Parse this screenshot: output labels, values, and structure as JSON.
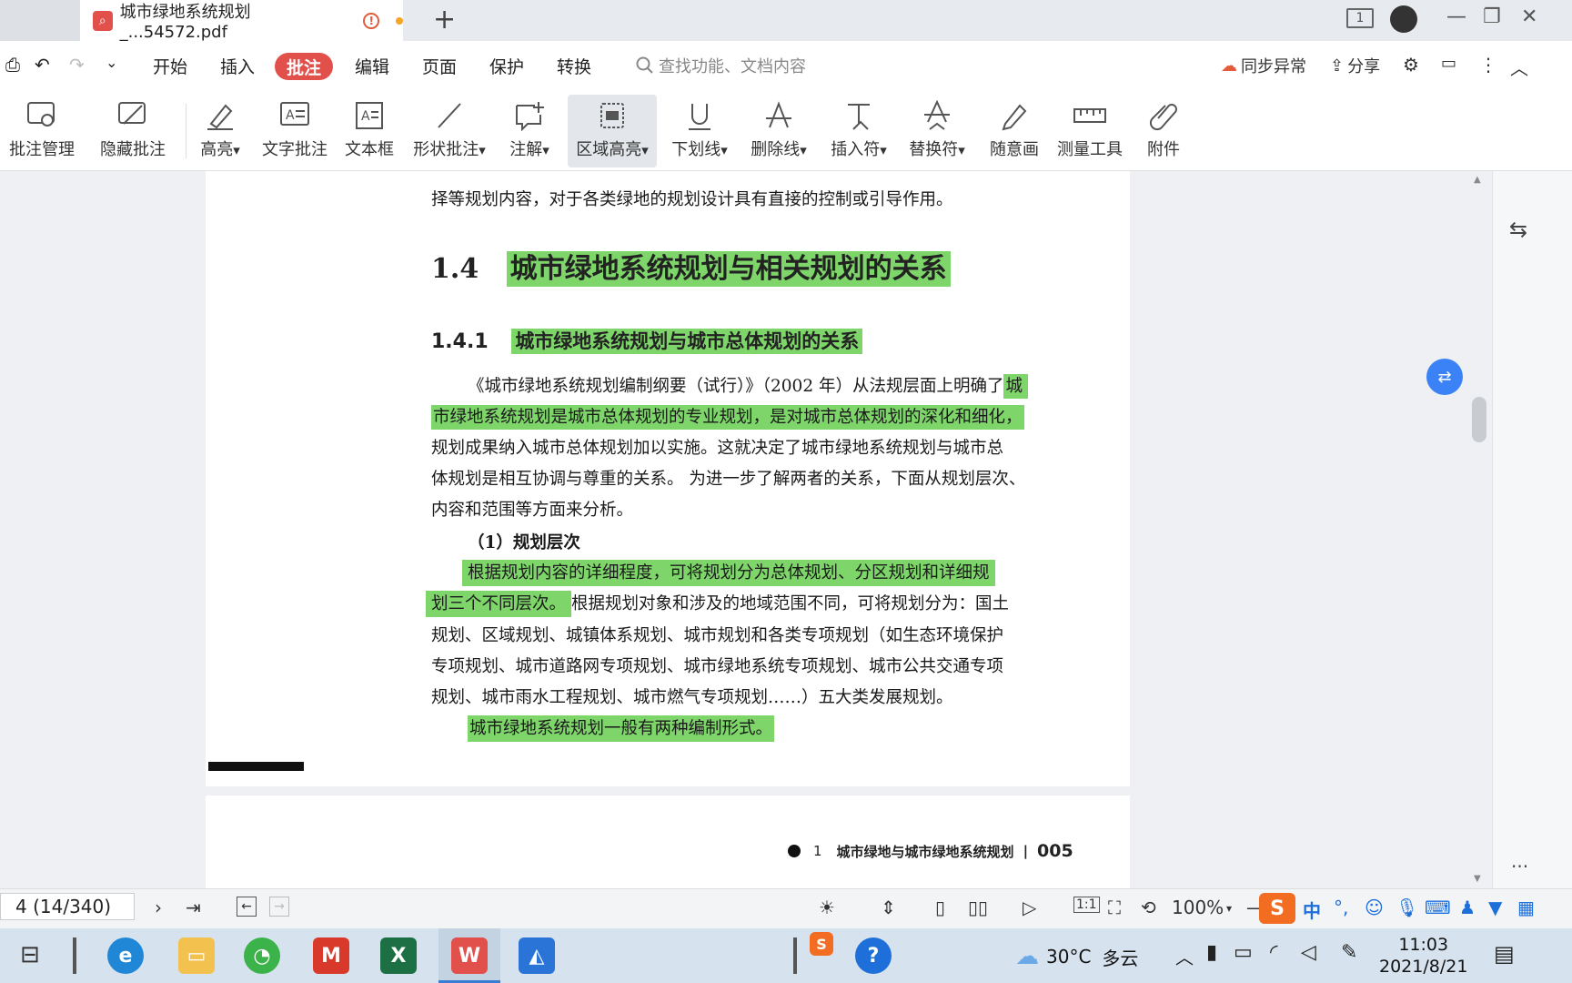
{
  "window": {
    "tab_title": "城市绿地系统规划_...54572.pdf",
    "new_tab": "+",
    "page_indicator": "1",
    "minimize": "—",
    "restore": "❐",
    "close": "✕"
  },
  "menu": {
    "items": [
      "开始",
      "插入",
      "批注",
      "编辑",
      "页面",
      "保护",
      "转换"
    ],
    "active": "批注",
    "search_placeholder": "查找功能、文档内容",
    "sync": "同步异常",
    "share": "分享"
  },
  "toolbar": {
    "tools": [
      {
        "label": "批注管理",
        "icon": "comment-gear-icon"
      },
      {
        "label": "隐藏批注",
        "icon": "comment-hide-icon"
      },
      {
        "label": "高亮",
        "icon": "highlighter-icon",
        "dropdown": true
      },
      {
        "label": "文字批注",
        "icon": "text-comment-icon"
      },
      {
        "label": "文本框",
        "icon": "textbox-icon"
      },
      {
        "label": "形状批注",
        "icon": "line-shape-icon",
        "dropdown": true
      },
      {
        "label": "注解",
        "icon": "annotation-icon",
        "dropdown": true
      },
      {
        "label": "区域高亮",
        "icon": "area-highlight-icon",
        "dropdown": true,
        "active": true
      },
      {
        "label": "下划线",
        "icon": "underline-icon",
        "dropdown": true
      },
      {
        "label": "删除线",
        "icon": "strikethrough-icon",
        "dropdown": true
      },
      {
        "label": "插入符",
        "icon": "insert-caret-icon",
        "dropdown": true
      },
      {
        "label": "替换符",
        "icon": "replace-caret-icon",
        "dropdown": true
      },
      {
        "label": "随意画",
        "icon": "pen-icon"
      },
      {
        "label": "测量工具",
        "icon": "ruler-icon"
      },
      {
        "label": "附件",
        "icon": "paperclip-icon"
      }
    ]
  },
  "document": {
    "top_line": "择等规划内容，对于各类绿地的规划设计具有直接的控制或引导作用。",
    "h14_num": "1.4",
    "h14_text": "城市绿地系统规划与相关规划的关系",
    "h141_num": "1.4.1",
    "h141_text": "城市绿地系统规划与城市总体规划的关系",
    "p1_l1a": "《城市绿地系统规划编制纲要（试行）》（2002 年）从法规层面上明确了",
    "p1_l1b": "城",
    "p1_l2": "市绿地系统规划是城市总体规划的专业规划，是对城市总体规划的深化和细化，",
    "p1_l3": "规划成果纳入城市总体规划加以实施。这就决定了城市绿地系统规划与城市总",
    "p1_l4": "体规划是相互协调与尊重的关系。 为进一步了解两者的关系，下面从规划层次、",
    "p1_l5": "内容和范围等方面来分析。",
    "sub1": "（1）规划层次",
    "p2_l1": "根据规划内容的详细程度，可将规划分为总体规划、分区规划和详细规",
    "p2_l2a": "划三个不同层次。",
    "p2_l2b": "根据规划对象和涉及的地域范围不同，可将规划分为：国土",
    "p2_l3": "规划、区域规划、城镇体系规划、城市规划和各类专项规划（如生态环境保护",
    "p2_l4": "专项规划、城市道路网专项规划、城市绿地系统专项规划、城市公共交通专项",
    "p2_l5": "规划、城市雨水工程规划、城市燃气专项规划……）五大类发展规划。",
    "p3": "城市绿地系统规划一般有两种编制形式。",
    "footer_chapter": "1",
    "footer_title": "城市绿地与城市绿地系统规划",
    "footer_page": "005",
    "highlight_color": "#7ed66a"
  },
  "statusbar": {
    "page": "4 (14/340)",
    "zoom": "100%"
  },
  "taskbar": {
    "weather_temp": "30°C",
    "weather_desc": "多云",
    "time": "11:03",
    "date": "2021/8/21",
    "ime": "中"
  }
}
